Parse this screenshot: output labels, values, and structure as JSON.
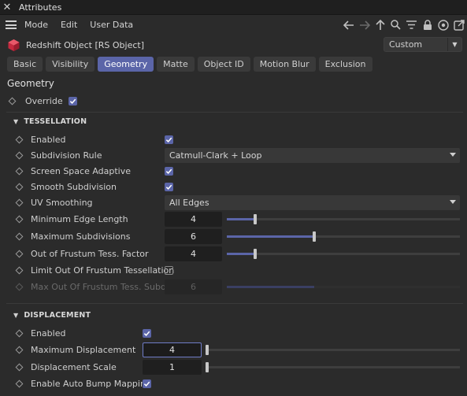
{
  "window": {
    "title": "Attributes",
    "close_glyph": "✕"
  },
  "menu": {
    "items": [
      "Mode",
      "Edit",
      "User Data"
    ]
  },
  "toolbar": {
    "icons": [
      "back-arrow-icon",
      "forward-arrow-icon",
      "up-arrow-icon",
      "search-icon",
      "filter-icon",
      "lock-icon",
      "target-icon",
      "new-window-icon"
    ]
  },
  "object": {
    "name": "Redshift Object [RS Object]",
    "icon": "redshift-cube-icon",
    "icon_color": "#d2354a"
  },
  "preset": {
    "value": "Custom"
  },
  "tabs": [
    {
      "label": "Basic",
      "active": false
    },
    {
      "label": "Visibility",
      "active": false
    },
    {
      "label": "Geometry",
      "active": true
    },
    {
      "label": "Matte",
      "active": false
    },
    {
      "label": "Object ID",
      "active": false
    },
    {
      "label": "Motion Blur",
      "active": false
    },
    {
      "label": "Exclusion",
      "active": false
    }
  ],
  "section_title": "Geometry",
  "override": {
    "label": "Override",
    "checked": true
  },
  "tessellation": {
    "header": "TESSELLATION",
    "enabled": {
      "label": "Enabled",
      "checked": true
    },
    "subdivision_rule": {
      "label": "Subdivision Rule",
      "value": "Catmull-Clark + Loop"
    },
    "screen_space_adaptive": {
      "label": "Screen Space Adaptive",
      "checked": true
    },
    "smooth_subdivision": {
      "label": "Smooth Subdivision",
      "checked": true
    },
    "uv_smoothing": {
      "label": "UV Smoothing",
      "value": "All Edges"
    },
    "min_edge_length": {
      "label": "Minimum Edge Length",
      "value": "4",
      "slider_fraction": 0.12
    },
    "max_subdivisions": {
      "label": "Maximum Subdivisions",
      "value": "6",
      "slider_fraction": 0.375
    },
    "out_of_frustum_factor": {
      "label": "Out of Frustum Tess. Factor",
      "value": "4",
      "slider_fraction": 0.12
    },
    "limit_out_of_frustum": {
      "label": "Limit Out Of Frustum Tessellation",
      "checked": false
    },
    "max_out_of_frustum_subdivs": {
      "label": "Max Out Of Frustum Tess. Subdivs",
      "value": "6",
      "slider_fraction": 0.375
    }
  },
  "displacement": {
    "header": "DISPLACEMENT",
    "enabled": {
      "label": "Enabled",
      "checked": true
    },
    "max_displacement": {
      "label": "Maximum Displacement",
      "value": "4",
      "slider_fraction": 0.0
    },
    "displacement_scale": {
      "label": "Displacement Scale",
      "value": "1",
      "slider_fraction": 0.003
    },
    "auto_bump": {
      "label": "Enable Auto Bump Mapping",
      "checked": true
    }
  },
  "colors": {
    "accent": "#5b65a8",
    "background": "#2b2b2b",
    "field": "#1f1f1f"
  }
}
